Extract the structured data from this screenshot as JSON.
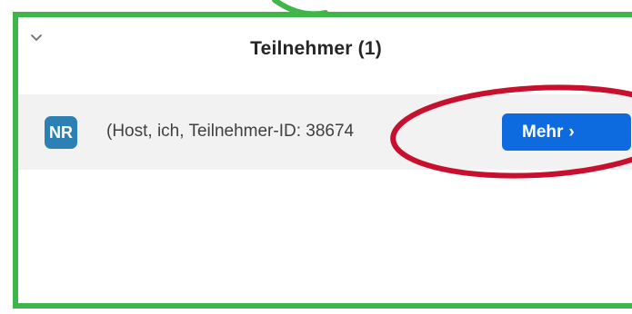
{
  "panel": {
    "title": "Teilnehmer (1)",
    "collapse_icon": "chevron-down-icon"
  },
  "participants": [
    {
      "initials": "NR",
      "avatar_color": "#2d80b4",
      "name_text": "(Host, ich, Teilnehmer-ID: 38674",
      "more_label": "Mehr",
      "more_chevron": "›"
    }
  ],
  "colors": {
    "frame_border": "#3fb54a",
    "highlight_ring": "#c8102e",
    "button_blue": "#0d6bdf",
    "row_background": "#f2f2f2"
  }
}
